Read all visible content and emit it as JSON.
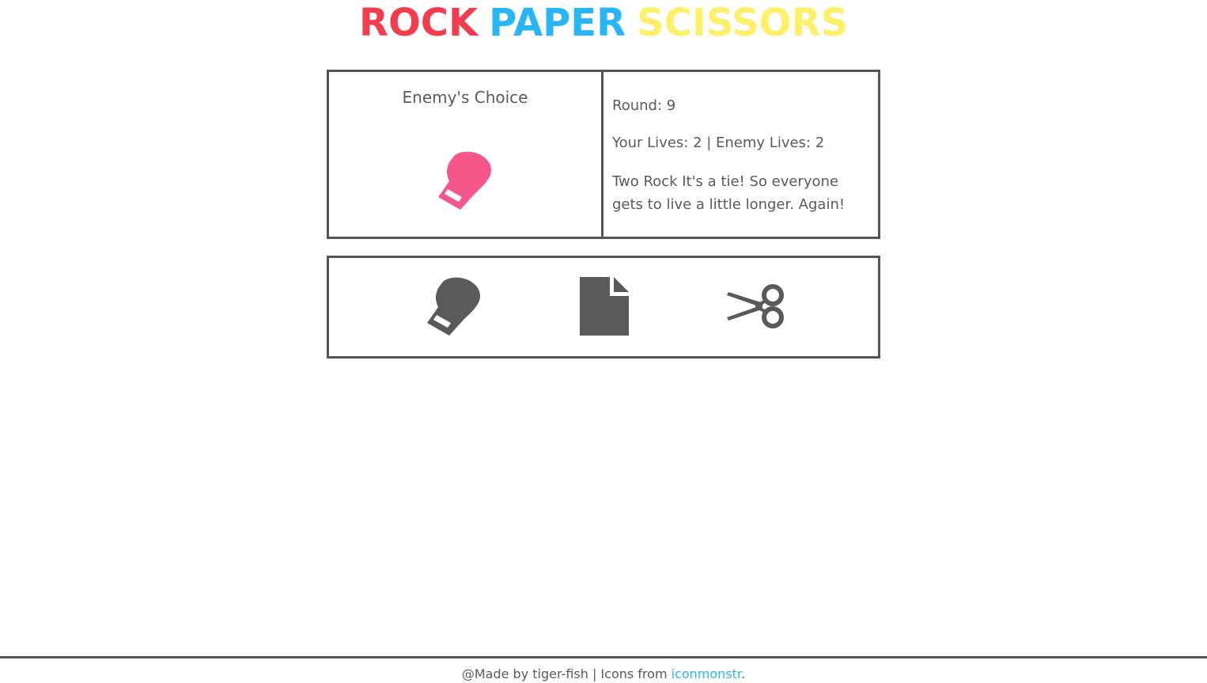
{
  "title": {
    "word1": "ROCK",
    "word2": "PAPER",
    "word3": "SCISSORS",
    "colors": {
      "rock": "#f23d4f",
      "paper": "#29b6f6",
      "scissors": "#fff06a"
    }
  },
  "enemy": {
    "heading": "Enemy's Choice",
    "choice_icon": "rock-glove-icon",
    "choice_color": "#f5578a"
  },
  "status": {
    "round": "Round: 9",
    "lives": "Your Lives: 2 | Enemy Lives: 2",
    "message": "Two Rock It's a tie! So everyone gets to live a little longer. Again!"
  },
  "choices": [
    {
      "name": "rock",
      "icon": "rock-glove-icon"
    },
    {
      "name": "paper",
      "icon": "paper-document-icon"
    },
    {
      "name": "scissors",
      "icon": "scissors-icon"
    }
  ],
  "icon_color": "#5a5a5a",
  "footer": {
    "prefix": "@Made by tiger-fish | Icons from ",
    "link_text": "iconmonstr",
    "suffix": ".",
    "link_color": "#29b6f6"
  }
}
